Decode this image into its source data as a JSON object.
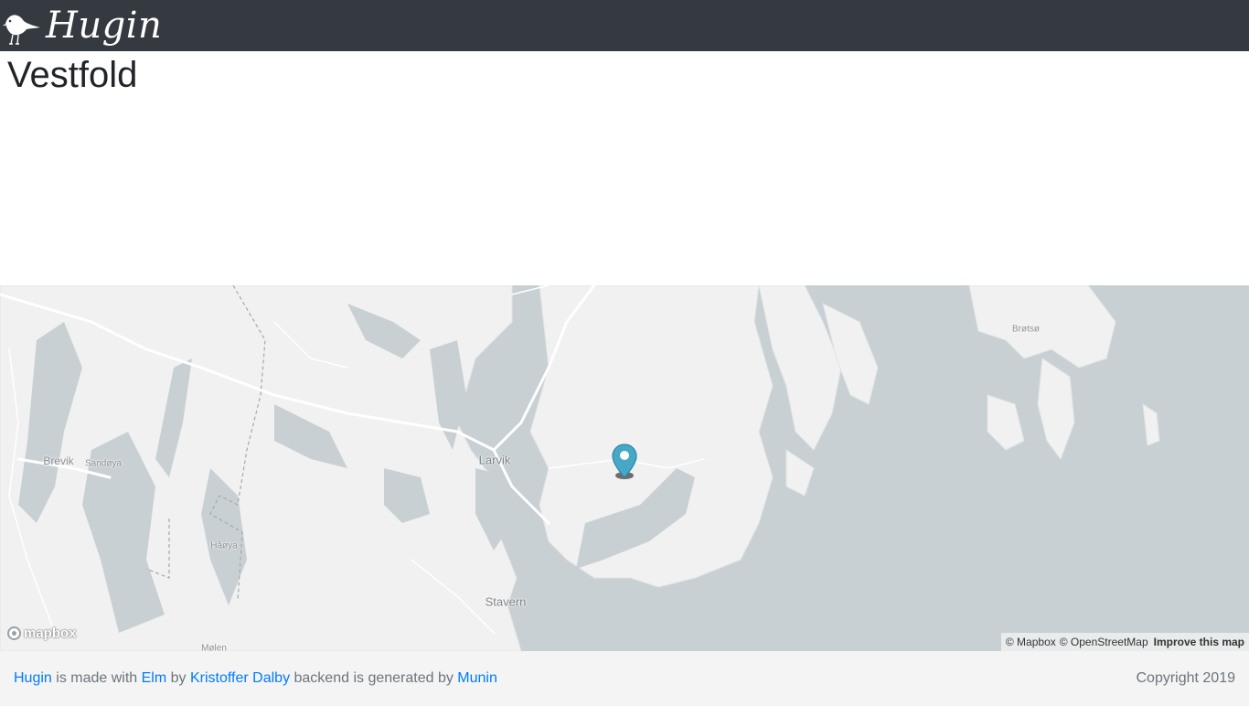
{
  "navbar": {
    "brand": "Hugin"
  },
  "page": {
    "title": "Vestfold"
  },
  "map": {
    "labels": {
      "brevik": "Brevik",
      "sandoya": "Sandøya",
      "larvik": "Larvik",
      "haoya": "Håøya",
      "stavern": "Stavern",
      "brotso": "Brøtsø",
      "molen": "Mølen"
    },
    "marker_color": "#46a7c7",
    "logo_text": "mapbox",
    "attribution": {
      "mapbox": "© Mapbox",
      "osm": "© OpenStreetMap",
      "improve": "Improve this map"
    }
  },
  "footer": {
    "hugin_link": "Hugin",
    "made_with_text": " is made with ",
    "elm_link": "Elm",
    "by_text": " by ",
    "author_link": "Kristoffer Dalby",
    "backend_text": " backend is generated by ",
    "munin_link": "Munin",
    "copyright": "Copyright 2019"
  }
}
